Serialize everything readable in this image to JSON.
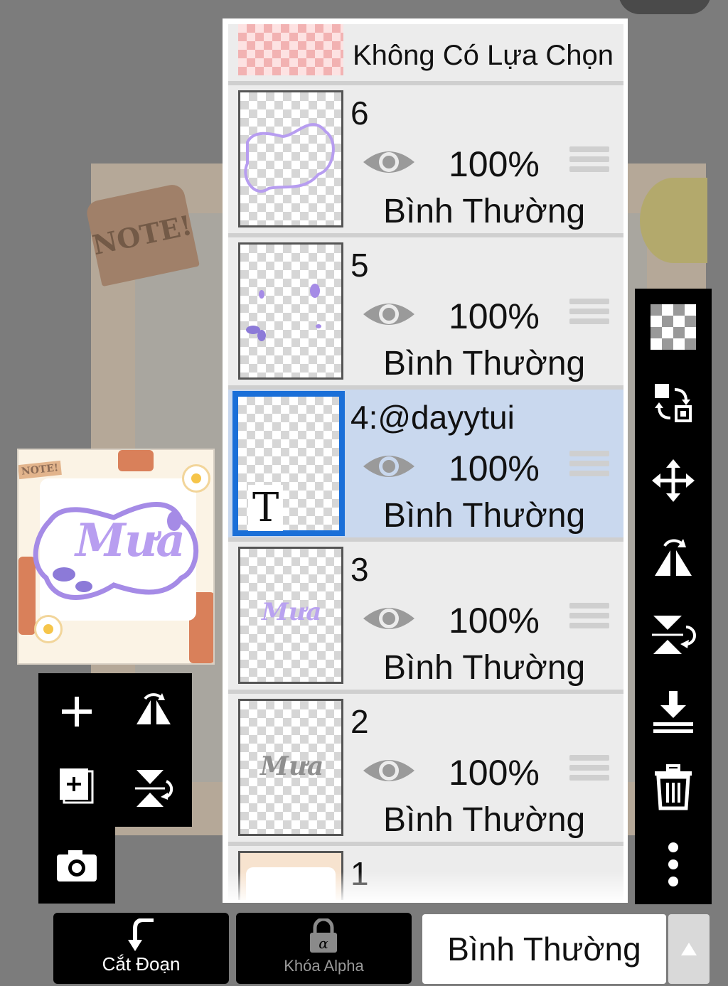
{
  "background": {
    "note_label": "NOTE!"
  },
  "preview": {
    "note_label": "NOTE!",
    "artwork_word": "Mưa"
  },
  "layers": [
    {
      "id": "selection",
      "label": "Không Có Lựa Chọn"
    },
    {
      "id": "6",
      "name": "6",
      "opacity": "100%",
      "blend": "Bình Thường"
    },
    {
      "id": "5",
      "name": "5",
      "opacity": "100%",
      "blend": "Bình Thường"
    },
    {
      "id": "4",
      "name": "4:@dayytui",
      "opacity": "100%",
      "blend": "Bình Thường",
      "selected": true,
      "type_glyph": "T"
    },
    {
      "id": "3",
      "name": "3",
      "opacity": "100%",
      "blend": "Bình Thường"
    },
    {
      "id": "2",
      "name": "2",
      "opacity": "100%",
      "blend": "Bình Thường"
    },
    {
      "id": "1",
      "name": "1"
    }
  ],
  "bottom_bar": {
    "clip_label": "Cắt Đoạn",
    "alpha_lock_label": "Khóa Alpha",
    "blend_mode_value": "Bình Thường"
  },
  "icons": {
    "left_tools": [
      "add-layer-icon",
      "flip-horizontal-icon",
      "add-copy-layer-icon",
      "flip-vertical-icon",
      "camera-icon"
    ],
    "right_tools": [
      "transparent-checker-icon",
      "swap-layers-icon",
      "move-icon",
      "flip-horizontal-icon",
      "flip-vertical-icon",
      "merge-down-icon",
      "trash-icon",
      "more-vertical-icon"
    ]
  },
  "colors": {
    "selected_row": "#c9d8ee",
    "selected_border": "#1a6fd8",
    "toolbar": "#000000"
  }
}
